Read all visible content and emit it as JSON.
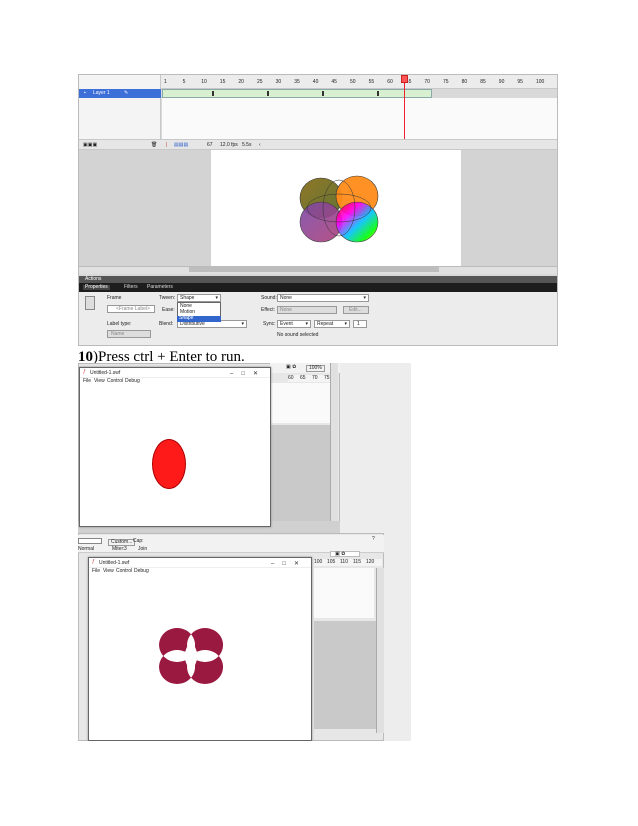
{
  "page": {
    "caption_number": "10",
    "caption_text": ")Press ctrl + Enter to run."
  },
  "shot1": {
    "layer_name": "Layer 1",
    "ruler_ticks": [
      "1",
      "5",
      "10",
      "15",
      "20",
      "25",
      "30",
      "35",
      "40",
      "45",
      "50",
      "55",
      "60",
      "65",
      "70",
      "75",
      "80",
      "85",
      "90",
      "95",
      "100"
    ],
    "timeline_status": {
      "frame": "67",
      "fps": "12.0 fps",
      "time": "5.5s"
    },
    "actions_label": "Actions",
    "tabs": [
      "Properties",
      "Filters",
      "Parameters"
    ],
    "props": {
      "frame_label": "Frame",
      "frame_placeholder": "<Frame Label>",
      "label_type_label": "Label type:",
      "label_type_value": "Name",
      "tween_label": "Tween:",
      "tween_value": "Shape",
      "tween_options": [
        "None",
        "Motion",
        "Shape"
      ],
      "ease_label": "Ease:",
      "blend_label": "Blend:",
      "blend_value": "Distributive",
      "sound_label": "Sound:",
      "sound_value": "None",
      "effect_label": "Effect:",
      "effect_value": "None",
      "edit_label": "Edit...",
      "sync_label": "Sync:",
      "sync_value": "Event",
      "repeat_value": "Repeat",
      "repeat_count": "1",
      "no_sound": "No sound selected"
    }
  },
  "shot2": {
    "window_title": "Untitled-1.swf",
    "menu": [
      "File",
      "View",
      "Control",
      "Debug"
    ],
    "ide_fragments": {
      "zoom": "100%",
      "custom_btn": "Custom...",
      "cap_label": "Cap:",
      "normal": "Normal",
      "miter_label": "Miter:",
      "miter_value": "3",
      "join": "Join"
    },
    "ruler_right_1": [
      "60",
      "65",
      "70",
      "75"
    ],
    "ruler_right_2": [
      "100",
      "105",
      "110",
      "115",
      "120"
    ],
    "colors": {
      "ball": "#ff1a1a",
      "flower": "#9a1940"
    }
  }
}
